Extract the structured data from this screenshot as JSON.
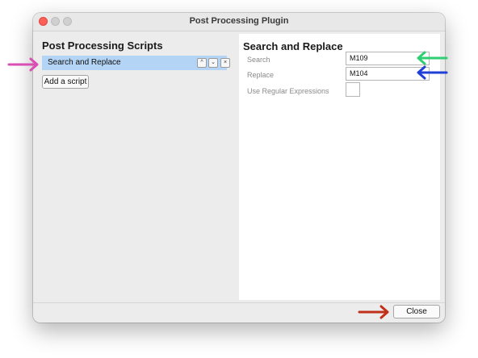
{
  "window": {
    "title": "Post Processing Plugin"
  },
  "scripts_panel": {
    "heading": "Post Processing Scripts",
    "scripts": [
      {
        "name": "Search and Replace"
      }
    ],
    "move_up_glyph": "^",
    "move_down_glyph": "⌄",
    "remove_glyph": "×",
    "add_button_label": "Add a script"
  },
  "settings_panel": {
    "heading": "Search and Replace",
    "search_label": "Search",
    "search_value": "M109",
    "replace_label": "Replace",
    "replace_value": "M104",
    "regex_label": "Use Regular Expressions",
    "regex_checked": false
  },
  "footer": {
    "close_label": "Close"
  },
  "annotation_colors": {
    "script_arrow": "#d94fb4",
    "search_arrow": "#2ecf72",
    "replace_arrow": "#1f3fd6",
    "close_arrow": "#c0301a"
  }
}
